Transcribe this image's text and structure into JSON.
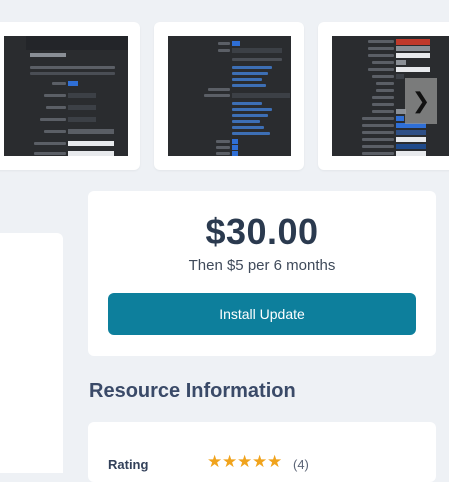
{
  "gallery": {
    "next_icon": "chevron-right-icon",
    "next_glyph": "❯"
  },
  "pricing": {
    "price": "$30.00",
    "renewal": "Then $5 per 6 months",
    "install_label": "Install Update"
  },
  "resource_info": {
    "title": "Resource Information",
    "rating_label": "Rating",
    "rating_value": 5,
    "rating_max": 5,
    "rating_count": "(4)"
  },
  "colors": {
    "accent": "#0d7f9c",
    "star": "#f0a31c",
    "heading": "#3a4a68",
    "price": "#2b3a4f"
  }
}
